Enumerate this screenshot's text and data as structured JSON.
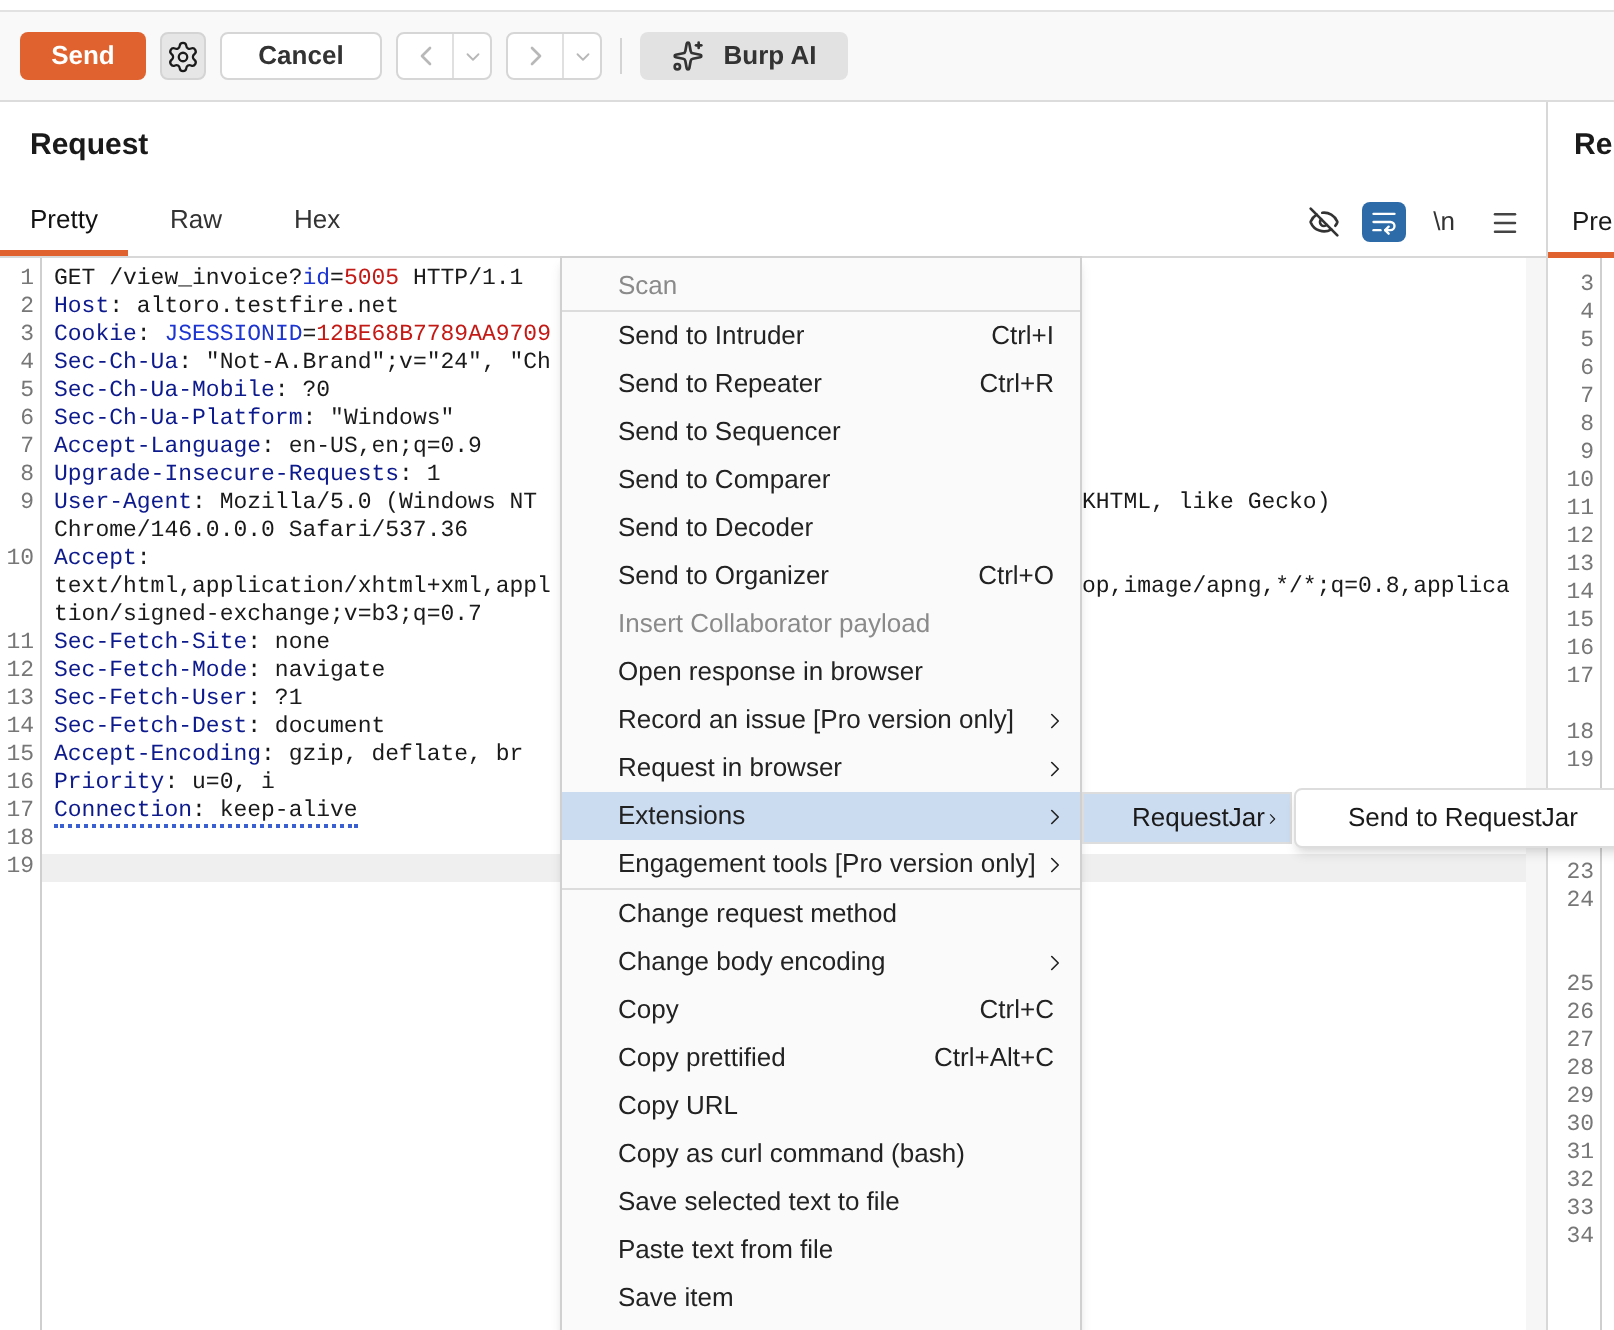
{
  "toolbar": {
    "send": {
      "label": "Send"
    },
    "cancel": {
      "label": "Cancel"
    },
    "back": {
      "disabled": true
    },
    "forward": {
      "disabled": true
    },
    "ai": {
      "label": "Burp AI"
    }
  },
  "request": {
    "title": "Request",
    "tabs": [
      {
        "label": "Pretty",
        "selected": true
      },
      {
        "label": "Raw",
        "selected": false
      },
      {
        "label": "Hex",
        "selected": false
      }
    ],
    "tools": [
      {
        "kind": "hide",
        "on": false
      },
      {
        "kind": "wrap",
        "on": true
      },
      {
        "kind": "newline",
        "label": "\\n",
        "on": false
      },
      {
        "kind": "menu"
      }
    ],
    "lines": [
      {
        "number": "1",
        "rows": [
          {
            "left": [
              {
                "kind": "plain",
                "text": "GET /view_invoice?"
              },
              {
                "kind": "param",
                "text": "id"
              },
              {
                "kind": "plain",
                "text": "="
              },
              {
                "kind": "value",
                "text": "5005"
              },
              {
                "kind": "plain",
                "text": " HTTP/1.1"
              }
            ]
          }
        ]
      },
      {
        "number": "2",
        "rows": [
          {
            "left": [
              {
                "kind": "name",
                "text": "Host"
              },
              {
                "kind": "plain",
                "text": ": altoro.testfire.net"
              }
            ]
          }
        ]
      },
      {
        "number": "3",
        "rows": [
          {
            "left": [
              {
                "kind": "name",
                "text": "Cookie"
              },
              {
                "kind": "plain",
                "text": ": "
              },
              {
                "kind": "param",
                "text": "JSESSIONID"
              },
              {
                "kind": "plain",
                "text": "="
              },
              {
                "kind": "value",
                "text": "12BE68B7789AA9709"
              }
            ]
          }
        ]
      },
      {
        "number": "4",
        "rows": [
          {
            "left": [
              {
                "kind": "name",
                "text": "Sec-Ch-Ua"
              },
              {
                "kind": "plain",
                "text": ": \"Not-A.Brand\";v=\"24\", \"Ch"
              }
            ]
          }
        ]
      },
      {
        "number": "5",
        "rows": [
          {
            "left": [
              {
                "kind": "name",
                "text": "Sec-Ch-Ua-Mobile"
              },
              {
                "kind": "plain",
                "text": ": ?0"
              }
            ]
          }
        ]
      },
      {
        "number": "6",
        "rows": [
          {
            "left": [
              {
                "kind": "name",
                "text": "Sec-Ch-Ua-Platform"
              },
              {
                "kind": "plain",
                "text": ": \"Windows\""
              }
            ]
          }
        ]
      },
      {
        "number": "7",
        "rows": [
          {
            "left": [
              {
                "kind": "name",
                "text": "Accept-Language"
              },
              {
                "kind": "plain",
                "text": ": en-US,en;q=0.9"
              }
            ]
          }
        ]
      },
      {
        "number": "8",
        "rows": [
          {
            "left": [
              {
                "kind": "name",
                "text": "Upgrade-Insecure-Requests"
              },
              {
                "kind": "plain",
                "text": ": 1"
              }
            ]
          }
        ]
      },
      {
        "number": "9",
        "rows": [
          {
            "left": [
              {
                "kind": "name",
                "text": "User-Agent"
              },
              {
                "kind": "plain",
                "text": ": Mozilla/5.0 (Windows NT"
              }
            ],
            "right": "KHTML, like Gecko)"
          },
          {
            "left": [
              {
                "kind": "plain",
                "text": "Chrome/146.0.0.0 Safari/537.36"
              }
            ]
          }
        ]
      },
      {
        "number": "10",
        "rows": [
          {
            "left": [
              {
                "kind": "name",
                "text": "Accept"
              },
              {
                "kind": "plain",
                "text": ":"
              }
            ]
          },
          {
            "left": [
              {
                "kind": "plain",
                "text": "text/html,application/xhtml+xml,appl"
              }
            ],
            "right": "op,image/apng,*/*;q=0.8,applica"
          },
          {
            "left": [
              {
                "kind": "plain",
                "text": "tion/signed-exchange;v=b3;q=0.7"
              }
            ]
          }
        ]
      },
      {
        "number": "11",
        "rows": [
          {
            "left": [
              {
                "kind": "name",
                "text": "Sec-Fetch-Site"
              },
              {
                "kind": "plain",
                "text": ": none"
              }
            ]
          }
        ]
      },
      {
        "number": "12",
        "rows": [
          {
            "left": [
              {
                "kind": "name",
                "text": "Sec-Fetch-Mode"
              },
              {
                "kind": "plain",
                "text": ": navigate"
              }
            ]
          }
        ]
      },
      {
        "number": "13",
        "rows": [
          {
            "left": [
              {
                "kind": "name",
                "text": "Sec-Fetch-User"
              },
              {
                "kind": "plain",
                "text": ": ?1"
              }
            ]
          }
        ]
      },
      {
        "number": "14",
        "rows": [
          {
            "left": [
              {
                "kind": "name",
                "text": "Sec-Fetch-Dest"
              },
              {
                "kind": "plain",
                "text": ": document"
              }
            ]
          }
        ]
      },
      {
        "number": "15",
        "rows": [
          {
            "left": [
              {
                "kind": "name",
                "text": "Accept-Encoding"
              },
              {
                "kind": "plain",
                "text": ": gzip, deflate, br"
              }
            ]
          }
        ]
      },
      {
        "number": "16",
        "rows": [
          {
            "left": [
              {
                "kind": "name",
                "text": "Priority"
              },
              {
                "kind": "plain",
                "text": ": u=0, i"
              }
            ]
          }
        ]
      },
      {
        "number": "17",
        "underlined": true,
        "rows": [
          {
            "left": [
              {
                "kind": "name",
                "text": "Connection"
              },
              {
                "kind": "plain",
                "text": ": keep-alive"
              }
            ]
          }
        ]
      },
      {
        "number": "18",
        "rows": [
          {
            "left": []
          }
        ]
      },
      {
        "number": "19",
        "current": true,
        "rows": [
          {
            "left": []
          }
        ]
      }
    ]
  },
  "response": {
    "title": "Re",
    "tab": "Pre",
    "gutter": [
      "3",
      "4",
      "5",
      "6",
      "7",
      "8",
      "9",
      "10",
      "11",
      "12",
      "13",
      "14",
      "15",
      "16",
      "17",
      "18",
      "19",
      "23",
      "24",
      "25",
      "26",
      "27",
      "28",
      "29",
      "30",
      "31",
      "32",
      "33",
      "34"
    ]
  },
  "context_menu": {
    "groups": [
      [
        {
          "label": "Scan",
          "disabled": true
        }
      ],
      [
        {
          "label": "Send to Intruder",
          "shortcut": "Ctrl+I"
        },
        {
          "label": "Send to Repeater",
          "shortcut": "Ctrl+R"
        },
        {
          "label": "Send to Sequencer"
        },
        {
          "label": "Send to Comparer"
        },
        {
          "label": "Send to Decoder"
        },
        {
          "label": "Send to Organizer",
          "shortcut": "Ctrl+O"
        },
        {
          "label": "Insert Collaborator payload",
          "disabled": true
        },
        {
          "label": "Open response in browser"
        },
        {
          "label": "Record an issue [Pro version only]",
          "submenu": true
        },
        {
          "label": "Request in browser",
          "submenu": true
        },
        {
          "label": "Extensions",
          "submenu": true,
          "highlighted": true
        },
        {
          "label": "Engagement tools [Pro version only]",
          "submenu": true
        }
      ],
      [
        {
          "label": "Change request method"
        },
        {
          "label": "Change body encoding",
          "submenu": true
        },
        {
          "label": "Copy",
          "shortcut": "Ctrl+C"
        },
        {
          "label": "Copy prettified",
          "shortcut": "Ctrl+Alt+C"
        },
        {
          "label": "Copy URL"
        },
        {
          "label": "Copy as curl command (bash)"
        },
        {
          "label": "Save selected text to file"
        },
        {
          "label": "Paste text from file"
        },
        {
          "label": "Save item"
        }
      ]
    ],
    "submenu": {
      "label": "RequestJar",
      "highlighted": true,
      "submenu": true
    },
    "submenu_2": {
      "label": "Send to RequestJar",
      "highlighted": false
    }
  }
}
